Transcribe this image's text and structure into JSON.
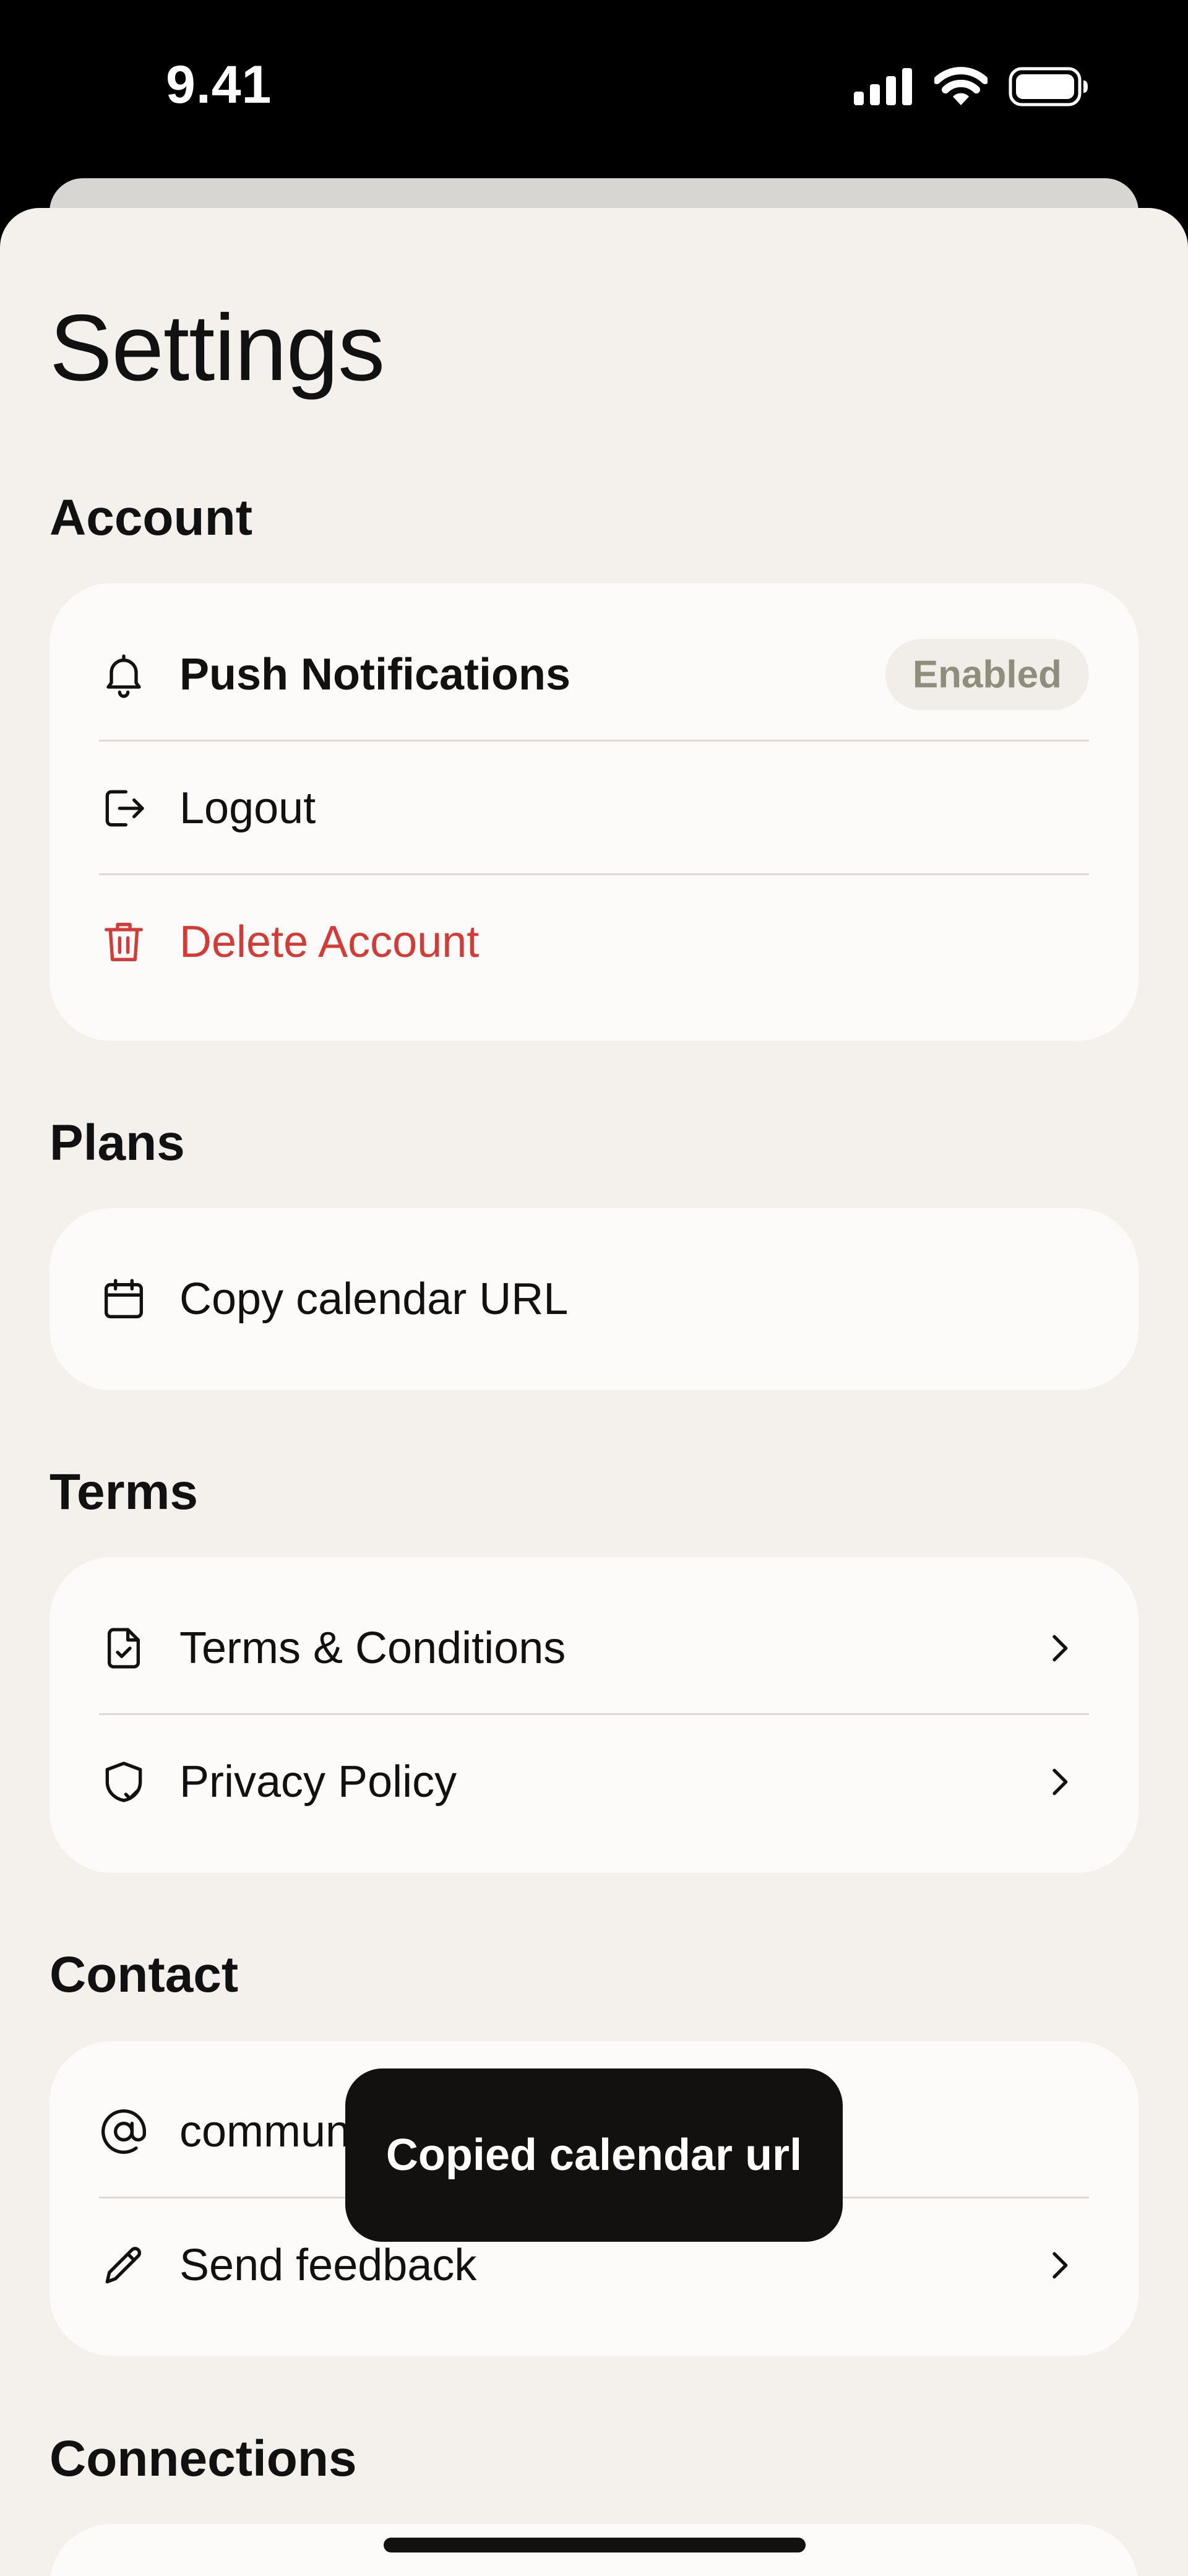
{
  "status_bar": {
    "time": "9.41",
    "icons": [
      "signal-icon",
      "wifi-icon",
      "battery-icon"
    ]
  },
  "page_title": "Settings",
  "sections": {
    "account": {
      "title": "Account",
      "items": [
        {
          "label": "Push Notifications",
          "icon": "bell-icon",
          "badge": "Enabled"
        },
        {
          "label": "Logout",
          "icon": "logout-icon"
        },
        {
          "label": "Delete Account",
          "icon": "trash-icon"
        }
      ]
    },
    "plans": {
      "title": "Plans",
      "items": [
        {
          "label": "Copy calendar URL",
          "icon": "calendar-icon"
        }
      ]
    },
    "terms": {
      "title": "Terms",
      "items": [
        {
          "label": "Terms & Conditions",
          "icon": "document-check-icon"
        },
        {
          "label": "Privacy Policy",
          "icon": "shield-check-icon"
        }
      ]
    },
    "contact": {
      "title": "Contact",
      "items": [
        {
          "label": "commun",
          "icon": "at-icon"
        },
        {
          "label": "Send feedback",
          "icon": "pencil-icon"
        }
      ]
    },
    "connections": {
      "title": "Connections"
    }
  },
  "toast": {
    "message": "Copied calendar url"
  },
  "colors": {
    "danger": "#d63a35",
    "background": "#f4f1ed",
    "card": "#fcfbf9",
    "toast": "#121110"
  }
}
